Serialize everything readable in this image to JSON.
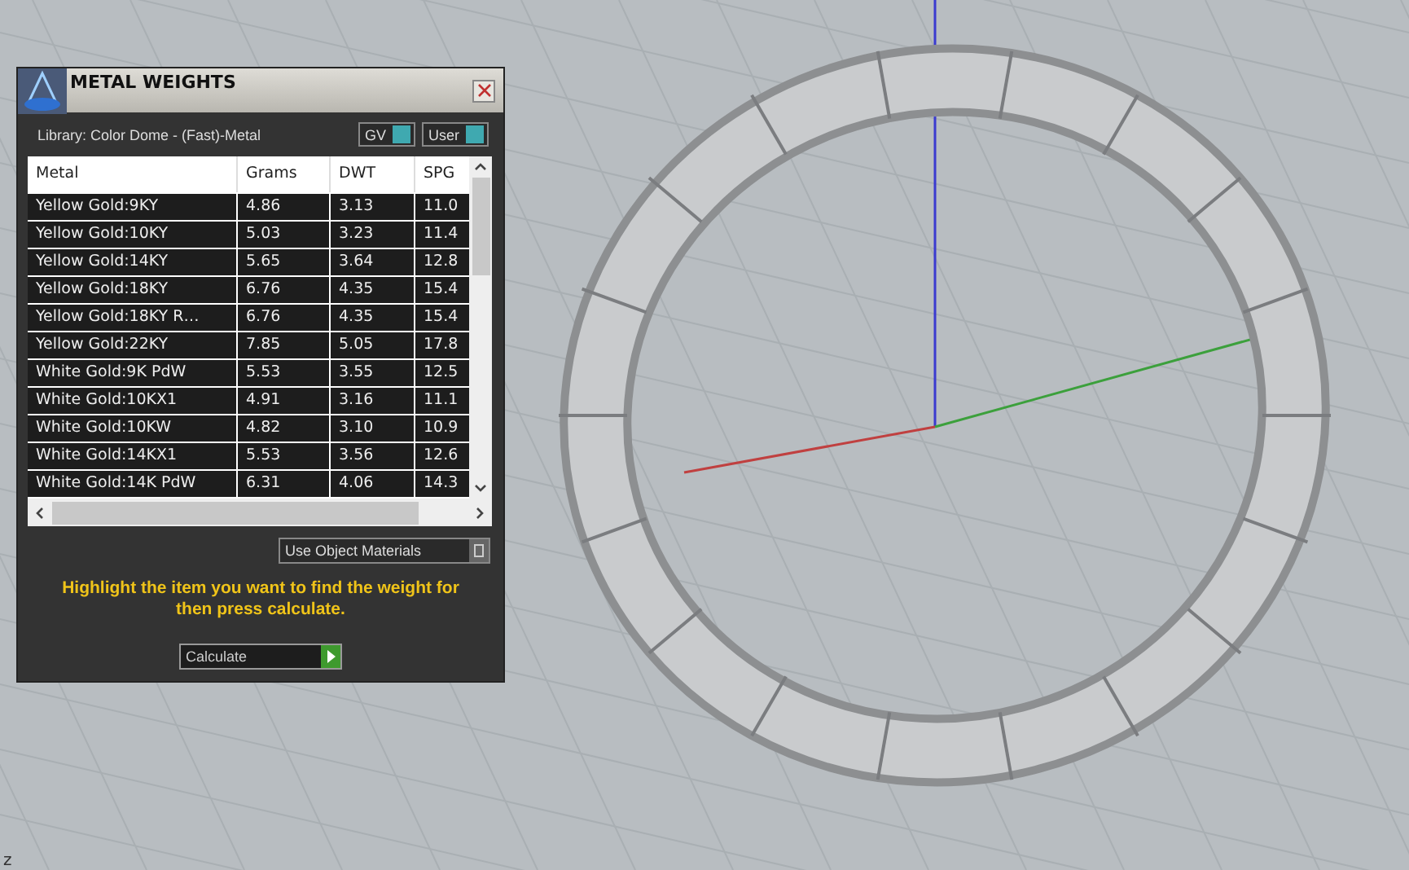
{
  "viewport": {
    "axis_label": "z"
  },
  "panel": {
    "title": "METAL WEIGHTS",
    "library": "Library: Color Dome - (Fast)-Metal",
    "toggles": [
      "GV",
      "User"
    ],
    "table": {
      "columns": [
        "Metal",
        "Grams",
        "DWT",
        "SPG"
      ],
      "rows": [
        [
          "Yellow Gold:9KY",
          "4.86",
          "3.13",
          "11.0"
        ],
        [
          "Yellow Gold:10KY",
          "5.03",
          "3.23",
          "11.4"
        ],
        [
          "Yellow Gold:14KY",
          "5.65",
          "3.64",
          "12.8"
        ],
        [
          "Yellow Gold:18KY",
          "6.76",
          "4.35",
          "15.4"
        ],
        [
          "Yellow Gold:18KY R…",
          "6.76",
          "4.35",
          "15.4"
        ],
        [
          "Yellow Gold:22KY",
          "7.85",
          "5.05",
          "17.8"
        ],
        [
          "White Gold:9K PdW",
          "5.53",
          "3.55",
          "12.5"
        ],
        [
          "White Gold:10KX1",
          "4.91",
          "3.16",
          "11.1"
        ],
        [
          "White Gold:10KW",
          "4.82",
          "3.10",
          "10.9"
        ],
        [
          "White Gold:14KX1",
          "5.53",
          "3.56",
          "12.6"
        ],
        [
          "White Gold:14K PdW",
          "6.31",
          "4.06",
          "14.3"
        ]
      ]
    },
    "materials_option": "Use Object Materials",
    "hint": "Highlight the item you want to find the weight for then press calculate.",
    "calculate_button": "Calculate"
  }
}
